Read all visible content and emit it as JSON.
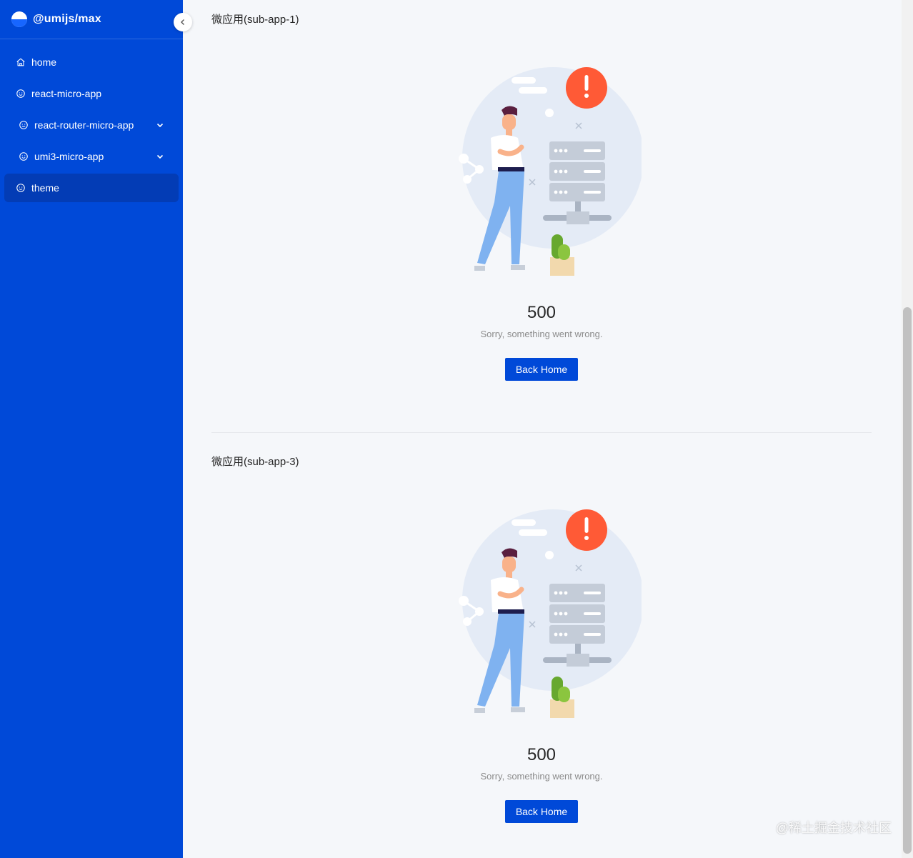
{
  "app": {
    "title": "@umijs/max"
  },
  "sidebar": {
    "items": [
      {
        "label": "home",
        "icon": "home-icon"
      },
      {
        "label": "react-micro-app",
        "icon": "smile-icon"
      },
      {
        "label": "react-router-micro-app",
        "icon": "smile-icon",
        "expandable": true
      },
      {
        "label": "umi3-micro-app",
        "icon": "smile-icon",
        "expandable": true
      },
      {
        "label": "theme",
        "icon": "smile-icon",
        "active": true
      }
    ],
    "collapse_icon": "chevron-left-icon"
  },
  "sections": [
    {
      "title": "微应用(sub-app-1)",
      "result": {
        "status": "500",
        "subtitle": "Sorry, something went wrong.",
        "button": "Back Home"
      }
    },
    {
      "title": "微应用(sub-app-3)",
      "result": {
        "status": "500",
        "subtitle": "Sorry, something went wrong.",
        "button": "Back Home"
      }
    }
  ],
  "watermark": "@稀土掘金技术社区",
  "colors": {
    "primary": "#0049d8",
    "active_menu": "#033cb5",
    "alert": "#ff5a36"
  }
}
